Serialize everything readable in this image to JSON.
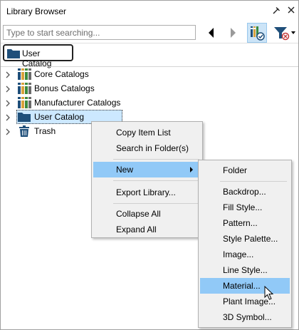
{
  "window": {
    "title": "Library Browser"
  },
  "toolbar": {
    "search_placeholder": "Type to start searching...",
    "back_icon": "back-arrow-icon",
    "forward_icon": "forward-arrow-icon",
    "view_icon": "library-view-icon",
    "filter_icon": "filter-icon"
  },
  "catalog_button": {
    "label": "User Catalog"
  },
  "tree": {
    "items": [
      {
        "label": "Core Catalogs",
        "icon": "catalog-books-icon"
      },
      {
        "label": "Bonus Catalogs",
        "icon": "catalog-books-icon"
      },
      {
        "label": "Manufacturer Catalogs",
        "icon": "catalog-books-icon"
      },
      {
        "label": "User Catalog",
        "icon": "folder-icon",
        "selected": true
      },
      {
        "label": "Trash",
        "icon": "trash-icon"
      }
    ]
  },
  "context_menu": {
    "items": [
      {
        "label": "Copy Item List"
      },
      {
        "label": "Search in Folder(s)"
      },
      {
        "label": "New",
        "highlighted": true
      },
      {
        "label": "Export Library..."
      },
      {
        "label": "Collapse All"
      },
      {
        "label": "Expand All"
      }
    ]
  },
  "submenu": {
    "items": [
      {
        "label": "Folder"
      },
      {
        "label": "Backdrop..."
      },
      {
        "label": "Fill Style..."
      },
      {
        "label": "Pattern..."
      },
      {
        "label": "Style Palette..."
      },
      {
        "label": "Image..."
      },
      {
        "label": "Line Style..."
      },
      {
        "label": "Material...",
        "highlighted": true
      },
      {
        "label": "Plant Image..."
      },
      {
        "label": "3D Symbol..."
      }
    ]
  },
  "colors": {
    "highlight": "#91c9f7",
    "selection": "#cce8ff",
    "folder": "#1f4f7a",
    "menu_bg": "#f0f0f0"
  }
}
